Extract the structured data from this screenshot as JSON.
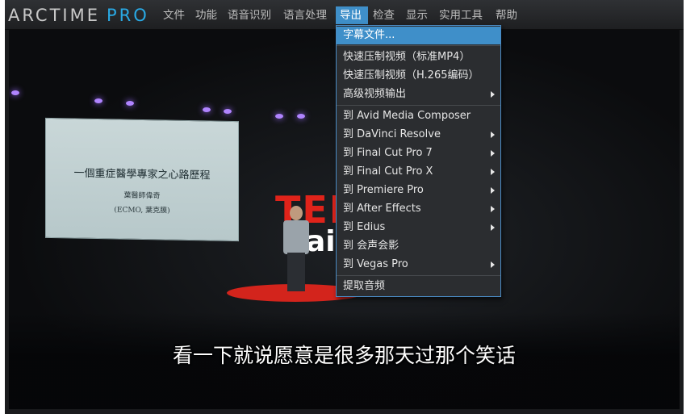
{
  "app": {
    "logo_main": "ARCTIME",
    "logo_sub": "PRO"
  },
  "menubar": {
    "items": [
      {
        "label": "文件"
      },
      {
        "label": "功能"
      },
      {
        "label": "语音识别"
      },
      {
        "label": "语言处理"
      },
      {
        "label": "导出",
        "active": true
      },
      {
        "label": "检查"
      },
      {
        "label": "显示"
      },
      {
        "label": "实用工具"
      },
      {
        "label": "帮助"
      }
    ]
  },
  "export_menu": {
    "items": [
      {
        "label": "字幕文件...",
        "highlighted": true,
        "submenu": false
      },
      {
        "label": "快速压制视频（标准MP4）",
        "submenu": false
      },
      {
        "label": "快速压制视频（H.265编码）",
        "submenu": false
      },
      {
        "label": "高级视频输出",
        "submenu": true
      },
      {
        "label": "到 Avid Media Composer",
        "submenu": false
      },
      {
        "label": "到 DaVinci Resolve",
        "submenu": true
      },
      {
        "label": "到 Final Cut Pro 7",
        "submenu": true
      },
      {
        "label": "到 Final Cut Pro X",
        "submenu": true
      },
      {
        "label": "到 Premiere Pro",
        "submenu": true
      },
      {
        "label": "到 After Effects",
        "submenu": true
      },
      {
        "label": "到 Edius",
        "submenu": true
      },
      {
        "label": "到 会声会影",
        "submenu": false
      },
      {
        "label": "到 Vegas Pro",
        "submenu": true
      },
      {
        "label": "提取音频",
        "submenu": false
      }
    ]
  },
  "video": {
    "slide_title": "一個重症醫學專家之心路歷程",
    "slide_author": "葉醫師偉奇",
    "slide_note": "(ECMO, 葉克膜)",
    "logo_text": "TED",
    "logo_sub": "aip",
    "subtitle": "看一下就说愿意是很多那天过那个笑话"
  },
  "colors": {
    "accent": "#3f8fc9",
    "logo_blue": "#29a9e4",
    "menubar_bg": "#2a2c2f",
    "menu_bg": "#2b2d30"
  }
}
